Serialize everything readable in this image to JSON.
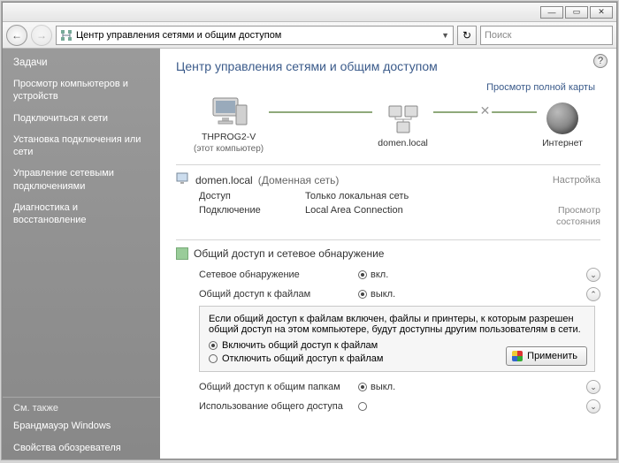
{
  "addressbar": {
    "path": "Центр управления сетями и общим доступом"
  },
  "search": {
    "placeholder": "Поиск"
  },
  "page": {
    "title": "Центр управления сетями и общим доступом",
    "maplink": "Просмотр полной карты"
  },
  "sidebar": {
    "tasks_label": "Задачи",
    "tasks": [
      "Просмотр компьютеров и устройств",
      "Подключиться к сети",
      "Установка подключения или сети",
      "Управление сетевыми подключениями",
      "Диагностика и восстановление"
    ],
    "seealso_label": "См. также",
    "seealso": [
      "Брандмауэр Windows",
      "Свойства обозревателя"
    ]
  },
  "netmap": {
    "this_pc": {
      "name": "THPROG2-V",
      "sub": "(этот компьютер)"
    },
    "domain": {
      "name": "domen.local"
    },
    "internet": {
      "name": "Интернет"
    }
  },
  "network": {
    "name": "domen.local",
    "type": "(Доменная сеть)",
    "config_label": "Настройка",
    "rows": {
      "access_label": "Доступ",
      "access_value": "Только локальная сеть",
      "conn_label": "Подключение",
      "conn_value": "Local Area Connection",
      "conn_action": "Просмотр состояния"
    }
  },
  "sharing": {
    "header": "Общий доступ и сетевое обнаружение",
    "rows": [
      {
        "label": "Сетевое обнаружение",
        "value": "вкл.",
        "on": true
      },
      {
        "label": "Общий доступ к файлам",
        "value": "выкл.",
        "on": false
      },
      {
        "label": "Общий доступ к общим папкам",
        "value": "выкл.",
        "on": false
      },
      {
        "label": "Использование общего доступа",
        "value": "",
        "on": false
      }
    ],
    "expand": {
      "desc": "Если общий доступ к файлам включен, файлы и принтеры, к которым разрешен общий доступ на этом компьютере, будут доступны другим пользователям в сети.",
      "opt_on": "Включить общий доступ к файлам",
      "opt_off": "Отключить общий доступ к файлам",
      "apply": "Применить"
    }
  }
}
